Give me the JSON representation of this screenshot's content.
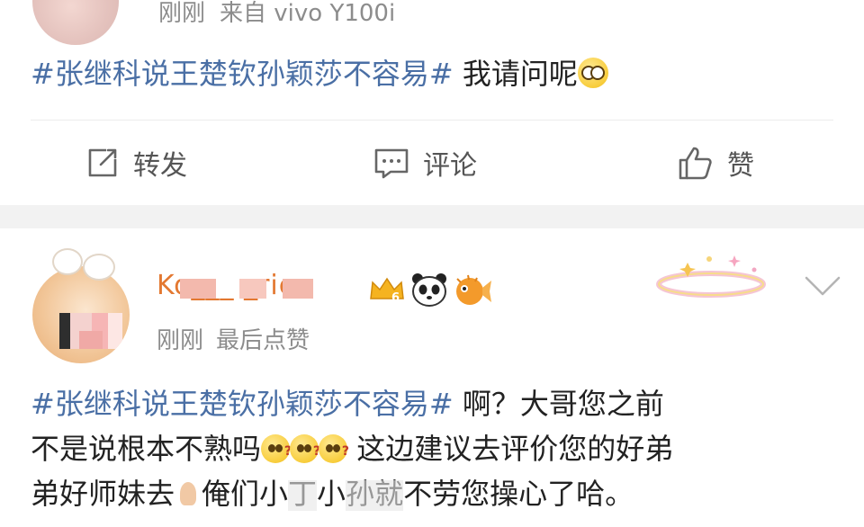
{
  "post1": {
    "time": "刚刚",
    "source": "来自 vivo Y100i",
    "hashtag": "#张继科说王楚钦孙颖莎不容易#",
    "text": " 我请问呢",
    "emoji": "glasses-face-emoji"
  },
  "actions": {
    "repost": "转发",
    "comment": "评论",
    "like": "赞"
  },
  "post2": {
    "username": "Ko___ _ric",
    "badges": [
      "crown-badge-6",
      "panda-icon",
      "pufferfish-icon"
    ],
    "level": "6",
    "time": "刚刚",
    "activity": "最后点赞",
    "hashtag": "#张继科说王楚钦孙颖莎不容易#",
    "line1": " 啊？大哥您之前",
    "line2a": "不是说根本不熟吗",
    "line2b": " 这边建议去评价您的好弟",
    "line3a": "弟好师妹去",
    "line3b": "俺们小",
    "line3c": "丁",
    "line3d": "小",
    "line3e": "孙",
    "line3f": "就",
    "line3g": "不劳您操心了哈。"
  },
  "colors": {
    "hashtag": "#4a6fa5",
    "meta": "#8c8c8c",
    "divider": "#f2f2f2"
  }
}
